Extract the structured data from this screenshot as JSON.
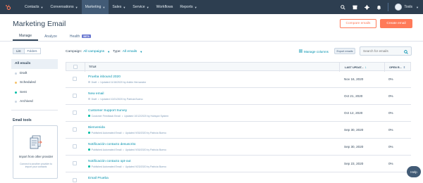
{
  "nav": {
    "items": [
      {
        "label": "Contacts",
        "active": false
      },
      {
        "label": "Conversations",
        "active": false
      },
      {
        "label": "Marketing",
        "active": true
      },
      {
        "label": "Sales",
        "active": false
      },
      {
        "label": "Service",
        "active": false
      },
      {
        "label": "Workflows",
        "active": false
      },
      {
        "label": "Reports",
        "active": false
      }
    ],
    "account_name": "Tools",
    "icons": [
      "search-icon",
      "marketplace-icon",
      "settings-icon",
      "notifications-icon"
    ]
  },
  "header": {
    "title": "Marketing Email",
    "compare_label": "Compare emails",
    "create_label": "Create email",
    "tabs": [
      {
        "label": "Manage",
        "active": true
      },
      {
        "label": "Analyze",
        "active": false
      },
      {
        "label": "Health",
        "active": false,
        "badge": "BETA"
      }
    ]
  },
  "sidebar": {
    "view_toggle": {
      "list": "List",
      "folders": "Folders"
    },
    "items": [
      {
        "label": "All emails",
        "active": true,
        "dot": ""
      },
      {
        "label": "Draft",
        "active": false,
        "dot": "#cbd6e2"
      },
      {
        "label": "Scheduled",
        "active": false,
        "dot": "#f5c26b"
      },
      {
        "label": "Sent",
        "active": false,
        "dot": "#00bda5"
      },
      {
        "label": "Archived",
        "active": false,
        "dot": "#cbd6e2"
      }
    ],
    "tools_title": "Email tools",
    "tool_card": {
      "title": "Import from other provider",
      "description": "Connect to another provider to import your contacts"
    }
  },
  "filters": {
    "campaign_label": "Campaign:",
    "campaign_value": "All campaigns",
    "type_label": "Type:",
    "type_value": "All emails",
    "manage_columns": "Manage columns",
    "export": "Export emails",
    "search_placeholder": "Search for emails"
  },
  "table": {
    "columns": [
      "TITLE",
      "LAST UPDAT...",
      "OPEN R..."
    ],
    "rows": [
      {
        "name": "Prueba inbound 2020",
        "status": "Draft",
        "status_color": "#cbd6e2",
        "updated": "Updated 11/16/2020 by Anibin Hernandez",
        "date": "Nov 16, 2020",
        "open": "0%"
      },
      {
        "name": "New email",
        "status": "Draft",
        "status_color": "#cbd6e2",
        "updated": "Updated 10/21/2020 by Patricia Bueno",
        "date": "Oct 21, 2020",
        "open": "0%"
      },
      {
        "name": "Customer Support Survey",
        "status": "Customer Feedback Email",
        "status_color": "#00bda5",
        "updated": "Updated 10/12/2020 by Hubspot System",
        "date": "Oct 12, 2020",
        "open": "0%"
      },
      {
        "name": "Bienvenida",
        "status": "Published Automated Email",
        "status_color": "#00bda5",
        "updated": "Updated 9/30/2020 by Patricia Bueno",
        "date": "Sep 30, 2020",
        "open": "0%"
      },
      {
        "name": "Notificación contacto desuscrito",
        "status": "Published Automated Email",
        "status_color": "#00bda5",
        "updated": "Updated 9/30/2020 by Patricia Bueno",
        "date": "Sep 30, 2020",
        "open": "0%"
      },
      {
        "name": "Notificación contacto opt-out",
        "status": "Published Automated Email",
        "status_color": "#00bda5",
        "updated": "Updated 9/23/2020 by Patricia Bueno",
        "date": "Sep 23, 2020",
        "open": "0%"
      },
      {
        "name": "Email Prueba",
        "status": "",
        "status_color": "#00bda5",
        "updated": "",
        "date": "",
        "open": ""
      }
    ]
  },
  "help_label": "Help",
  "colors": {
    "nav_bg": "#2d3e50",
    "accent": "#ff7a59",
    "link": "#0091ae"
  }
}
